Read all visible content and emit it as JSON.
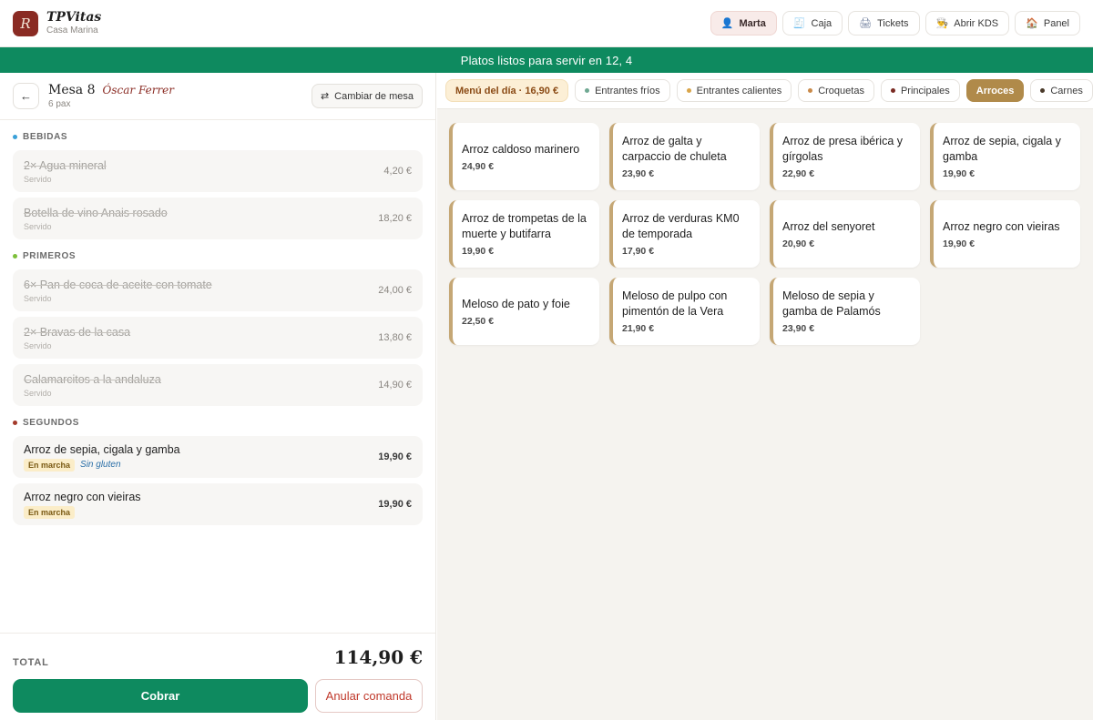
{
  "app": {
    "name": "TPVitas",
    "subtitle": "Casa Marina",
    "logo_letter": "R"
  },
  "nav": [
    {
      "label": "Marta",
      "icon": "user-icon",
      "glyph": "👤",
      "active": true
    },
    {
      "label": "Caja",
      "icon": "receipt-icon",
      "glyph": "🧾"
    },
    {
      "label": "Tickets",
      "icon": "printer-icon",
      "glyph": "🖨"
    },
    {
      "label": "Abrir KDS",
      "icon": "chef-icon",
      "glyph": "👨‍🍳"
    },
    {
      "label": "Panel",
      "icon": "home-icon",
      "glyph": "🏠"
    }
  ],
  "banner": "Platos listos para servir en 12, 4",
  "order": {
    "table": "Mesa 8",
    "waiter": "Óscar Ferrer",
    "pax": "6 pax",
    "change_table": "Cambiar de mesa",
    "sections": [
      {
        "title": "BEBIDAS",
        "color": "#3aa0d8",
        "items": [
          {
            "name": "2× Agua mineral",
            "status": "Servido",
            "price": "4,20 €"
          },
          {
            "name": "Botella de vino Anais rosado",
            "status": "Servido",
            "price": "18,20 €"
          }
        ]
      },
      {
        "title": "PRIMEROS",
        "color": "#7cbf3a",
        "items": [
          {
            "name": "6× Pan de coca de aceite con tomate",
            "status": "Servido",
            "price": "24,00 €"
          },
          {
            "name": "2× Bravas de la casa",
            "status": "Servido",
            "price": "13,80 €"
          },
          {
            "name": "Calamarcitos a la andaluza",
            "status": "Servido",
            "price": "14,90 €"
          }
        ]
      },
      {
        "title": "SEGUNDOS",
        "color": "#a33a2b",
        "items": [
          {
            "name": "Arroz de sepia, cigala y gamba",
            "tag": "En marcha",
            "note": "Sin gluten",
            "price": "19,90 €"
          },
          {
            "name": "Arroz negro con vieiras",
            "tag": "En marcha",
            "price": "19,90 €"
          }
        ]
      }
    ],
    "total_label": "TOTAL",
    "total": "114,90 €",
    "pay": "Cobrar",
    "cancel": "Anular comanda"
  },
  "categories": [
    {
      "label": "Menú del día · 16,90 €",
      "kind": "menu"
    },
    {
      "label": "Entrantes fríos",
      "dot": "#6fa892"
    },
    {
      "label": "Entrantes calientes",
      "dot": "#d9a54a"
    },
    {
      "label": "Croquetas",
      "dot": "#c98a4a"
    },
    {
      "label": "Principales",
      "dot": "#7a2b23"
    },
    {
      "label": "Arroces",
      "active": true
    },
    {
      "label": "Carnes",
      "dot": "#4a3a2a"
    }
  ],
  "dishes": [
    {
      "name": "Arroz caldoso marinero",
      "price": "24,90 €"
    },
    {
      "name": "Arroz de galta y carpaccio de chuleta",
      "price": "23,90 €"
    },
    {
      "name": "Arroz de presa ibérica y gírgolas",
      "price": "22,90 €"
    },
    {
      "name": "Arroz de sepia, cigala y gamba",
      "price": "19,90 €"
    },
    {
      "name": "Arroz de trompetas de la muerte y butifarra",
      "price": "19,90 €"
    },
    {
      "name": "Arroz de verduras KM0 de temporada",
      "price": "17,90 €"
    },
    {
      "name": "Arroz del senyoret",
      "price": "20,90 €"
    },
    {
      "name": "Arroz negro con vieiras",
      "price": "19,90 €"
    },
    {
      "name": "Meloso de pato y foie",
      "price": "22,50 €"
    },
    {
      "name": "Meloso de pulpo con pimentón de la Vera",
      "price": "21,90 €"
    },
    {
      "name": "Meloso de sepia y gamba de Palamós",
      "price": "23,90 €"
    }
  ],
  "colors": {
    "accent_green": "#0e8a5f",
    "brand": "#8a2b23",
    "category_active": "#b08a4a",
    "dish_border": "#c5a775"
  }
}
